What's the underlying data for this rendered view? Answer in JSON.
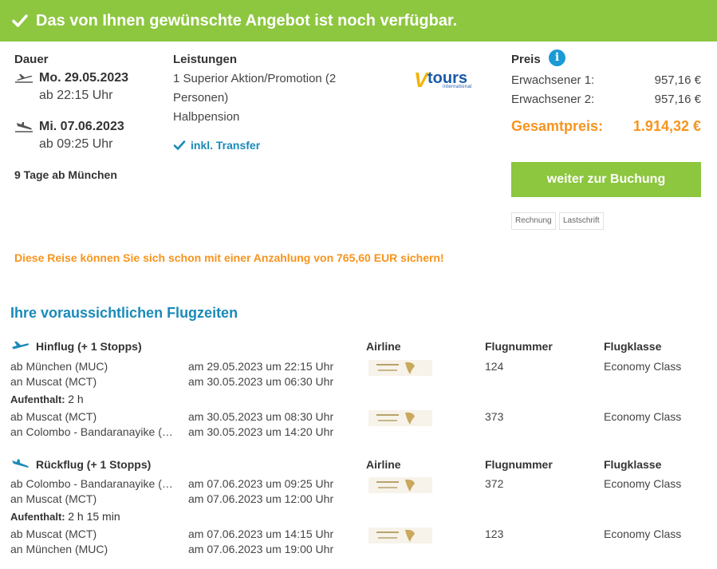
{
  "banner": {
    "text": "Das von Ihnen gewünschte Angebot ist noch verfügbar."
  },
  "duration": {
    "label": "Dauer",
    "outbound_date": "Mo. 29.05.2023",
    "outbound_time": "ab 22:15 Uhr",
    "return_date": "Mi. 07.06.2023",
    "return_time": "ab 09:25 Uhr",
    "summary": "9 Tage ab München"
  },
  "services": {
    "label": "Leistungen",
    "description": "1 Superior Aktion/Promotion (2 Personen)",
    "board": "Halbpension",
    "transfer": "inkl. Transfer"
  },
  "operator_logo": {
    "main": "tours",
    "v": "V",
    "sub": "international"
  },
  "price": {
    "label": "Preis",
    "info_icon": "i",
    "adult1_label": "Erwachsener 1:",
    "adult1_amount": "957,16 €",
    "adult2_label": "Erwachsener 2:",
    "adult2_amount": "957,16 €",
    "total_label": "Gesamtpreis:",
    "total_amount": "1.914,32 €",
    "book_button": "weiter zur Buchung",
    "payment_methods": [
      "Rechnung",
      "Lastschrift"
    ]
  },
  "deposit_note": "Diese Reise können Sie sich schon mit einer Anzahlung von 765,60 EUR sichern!",
  "flights": {
    "title": "Ihre voraussichtlichen Flugzeiten",
    "columns": {
      "airline": "Airline",
      "flight_number": "Flugnummer",
      "class": "Flugklasse"
    },
    "outbound": {
      "heading": "Hinflug (+ 1 Stopps)",
      "segments": [
        {
          "from": "ab München (MUC)",
          "to": "an Muscat (MCT)",
          "dep": "am 29.05.2023 um 22:15 Uhr",
          "arr": "am 30.05.2023 um 06:30 Uhr",
          "number": "124",
          "class": "Economy Class"
        },
        {
          "from": "ab Muscat (MCT)",
          "to": "an Colombo - Bandaranayike (…",
          "dep": "am 30.05.2023 um 08:30 Uhr",
          "arr": "am 30.05.2023 um 14:20 Uhr",
          "number": "373",
          "class": "Economy Class"
        }
      ],
      "stopover_label": "Aufenthalt:",
      "stopover_value": "2 h"
    },
    "return": {
      "heading": "Rückflug (+ 1 Stopps)",
      "segments": [
        {
          "from": "ab Colombo - Bandaranayike (…",
          "to": "an Muscat (MCT)",
          "dep": "am 07.06.2023 um 09:25 Uhr",
          "arr": "am 07.06.2023 um 12:00 Uhr",
          "number": "372",
          "class": "Economy Class"
        },
        {
          "from": "ab Muscat (MCT)",
          "to": "an München (MUC)",
          "dep": "am 07.06.2023 um 14:15 Uhr",
          "arr": "am 07.06.2023 um 19:00 Uhr",
          "number": "123",
          "class": "Economy Class"
        }
      ],
      "stopover_label": "Aufenthalt:",
      "stopover_value": "2 h 15 min"
    }
  },
  "colors": {
    "green": "#8dc63f",
    "orange": "#f7941d",
    "blue": "#1a8ab8"
  }
}
